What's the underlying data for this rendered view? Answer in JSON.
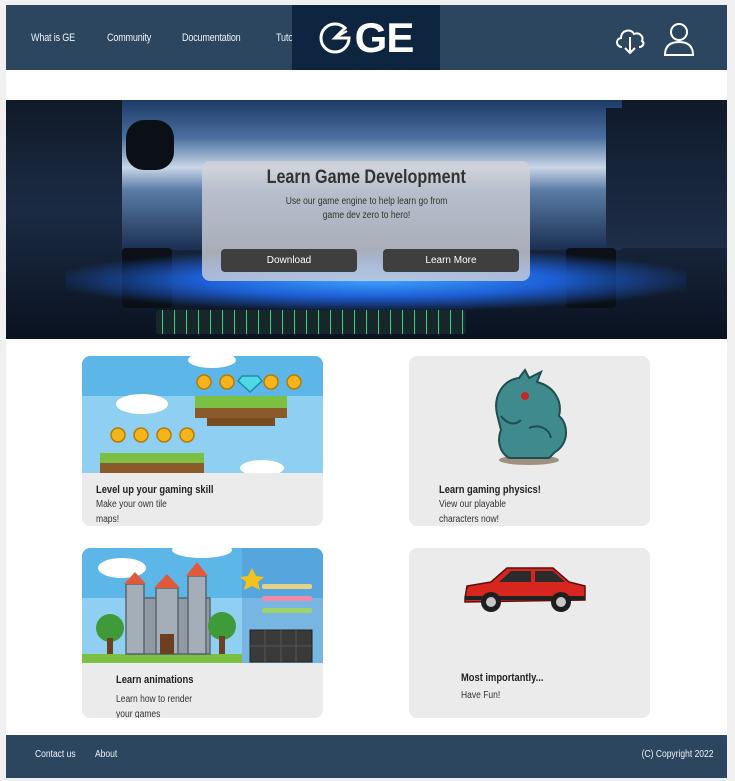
{
  "header": {
    "nav": [
      "What is GE",
      "Community",
      "Documentation",
      "Tutorial"
    ],
    "logo_text": "GE",
    "icons": [
      "cloud-download-icon",
      "user-icon"
    ]
  },
  "hero": {
    "title": "Learn Game Development",
    "subtitle": "Use our game engine to help learn go from game dev zero to hero!",
    "download_label": "Download",
    "learn_more_label": "Learn More"
  },
  "cards": [
    {
      "title": "Level up your gaming skill",
      "desc": "Make your own tile maps!"
    },
    {
      "title": "Learn gaming physics!",
      "desc": "View our playable characters now!"
    },
    {
      "title": "Learn animations",
      "desc": "Learn how to render your games"
    },
    {
      "title": "Most importantly...",
      "desc": "Have Fun!"
    }
  ],
  "footer": {
    "contact": "Contact us",
    "about": "About",
    "copyright": "(C) Copyright 2022"
  },
  "colors": {
    "header_bg": "#2c4660",
    "logo_bg": "#0e2540",
    "card_bg": "#ebebeb",
    "button_bg": "#3f3f3f"
  }
}
